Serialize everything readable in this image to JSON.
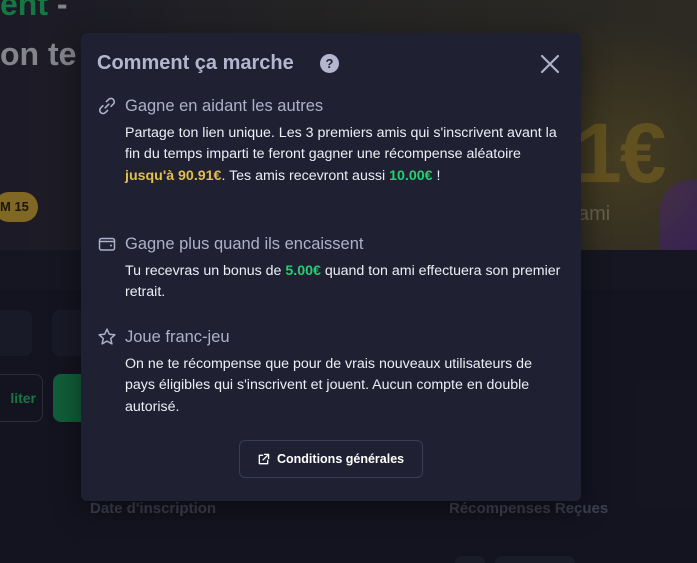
{
  "background": {
    "hero_line1_green": "ent",
    "hero_line1_rest": " -",
    "hero_line2": "on te",
    "badge": "M 15",
    "hero_amount": "1€",
    "hero_sub": "ami",
    "edit_button": "liter",
    "columns": {
      "signup_date": "Date d'inscription",
      "rewards_received": "Récompenses Reçues"
    }
  },
  "modal": {
    "title": "Comment ça marche",
    "help_icon": "?",
    "sections": [
      {
        "icon": "link-icon",
        "heading": "Gagne en aidant les autres",
        "text_a": "Partage ton lien unique. Les 3 premiers amis qui s'inscrivent avant la fin du temps imparti te feront gagner une récompense aléatoire ",
        "highlight_a": "jusqu'à 90.91€",
        "text_b": ". Tes amis recevront aussi ",
        "highlight_b": "10.00€",
        "text_c": " !"
      },
      {
        "icon": "wallet-icon",
        "heading": "Gagne plus quand ils encaissent",
        "text_a": "Tu recevras un bonus de ",
        "highlight_a": "5.00€",
        "text_b": " quand ton ami effectuera son premier retrait."
      },
      {
        "icon": "star-icon",
        "heading": "Joue franc-jeu",
        "text_a": "On ne te récompense que pour de vrais nouveaux utilisateurs de pays éligibles qui s'inscrivent et jouent. Aucun compte en double autorisé."
      }
    ],
    "terms_button": "Conditions générales"
  },
  "colors": {
    "modal_bg": "#1f2133",
    "accent_green": "#22d070",
    "accent_yellow": "#e2bf4a",
    "heading": "#aeb0c8"
  }
}
